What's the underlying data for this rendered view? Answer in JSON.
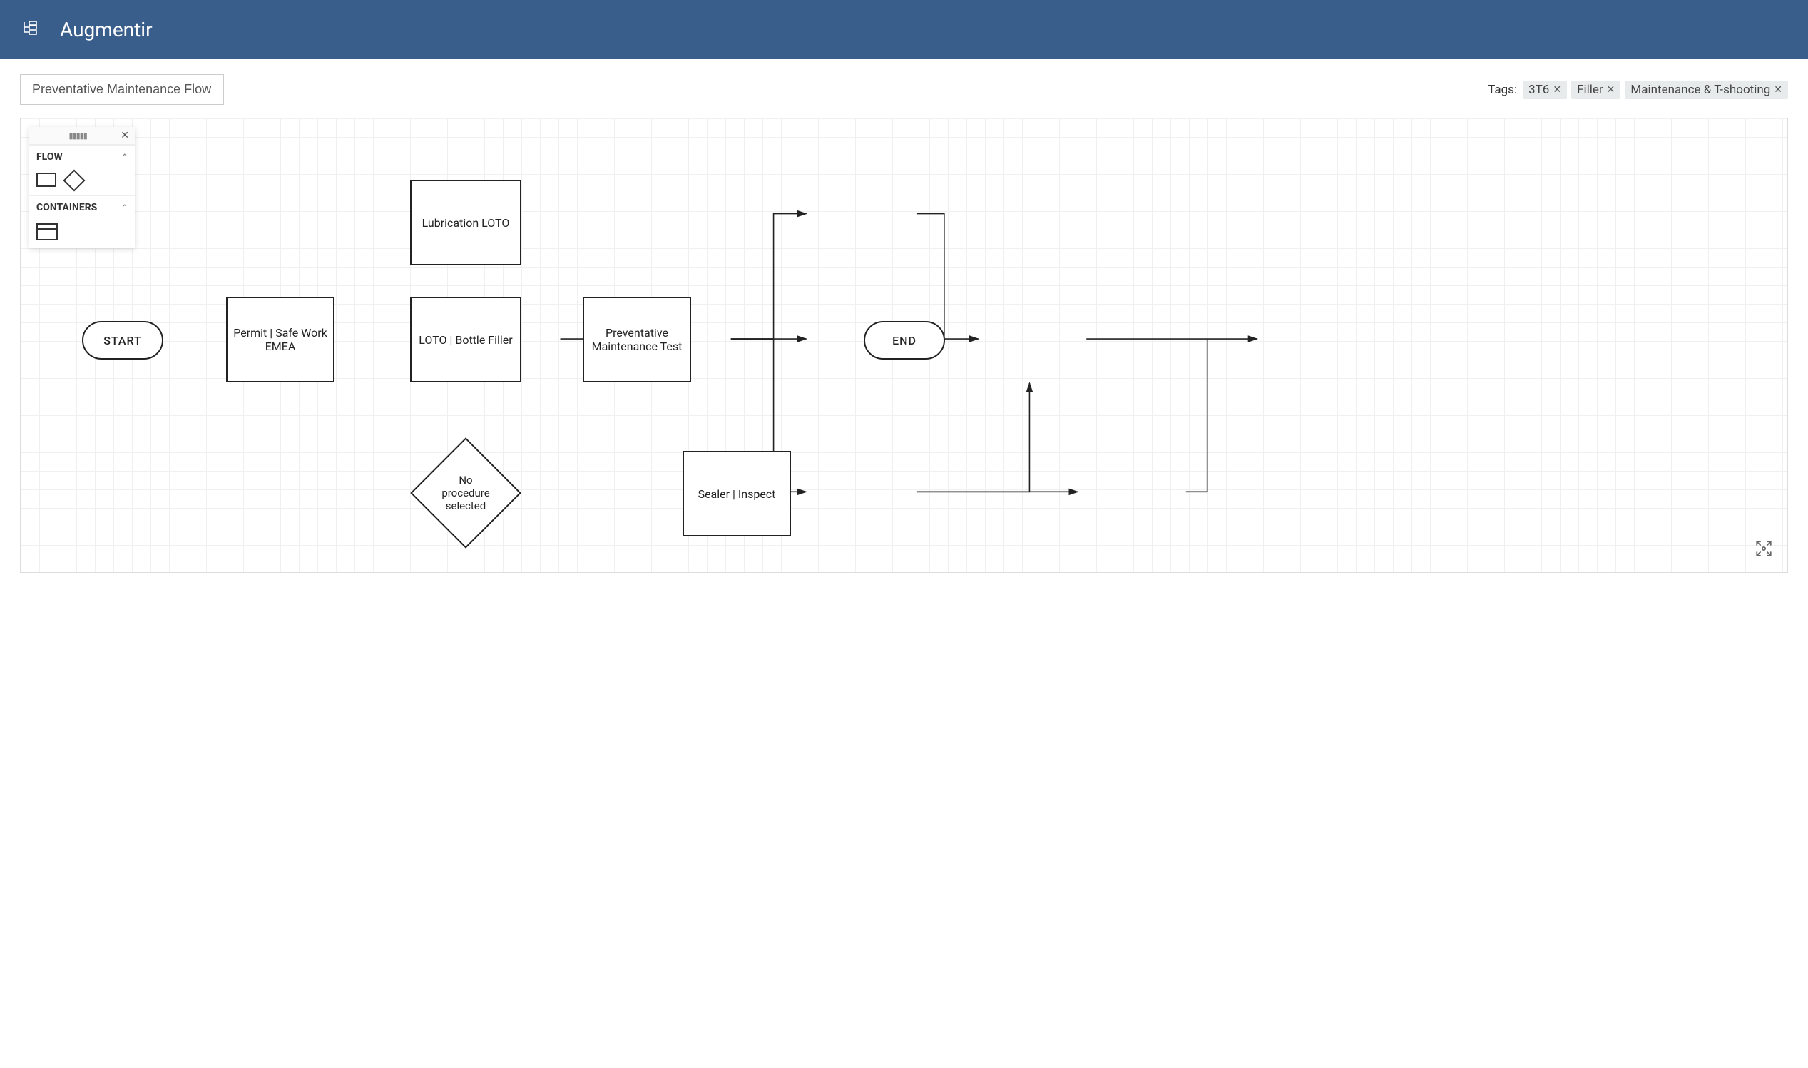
{
  "header": {
    "app_name": "Augmentir"
  },
  "toolbar": {
    "flow_name": "Preventative Maintenance Flow",
    "tags_label": "Tags:",
    "tags": [
      "3T6",
      "Filler",
      "Maintenance & T-shooting"
    ]
  },
  "palette": {
    "sections": {
      "flow_label": "FLOW",
      "containers_label": "CONTAINERS"
    }
  },
  "nodes": {
    "start": "START",
    "permit": "Permit | Safe Work EMEA",
    "lub_loto": "Lubrication LOTO",
    "loto_bottle": "LOTO | Bottle Filler",
    "pm_test": "Preventative Maintenance Test",
    "no_proc": "No procedure selected",
    "sealer": "Sealer | Inspect",
    "end": "END"
  }
}
